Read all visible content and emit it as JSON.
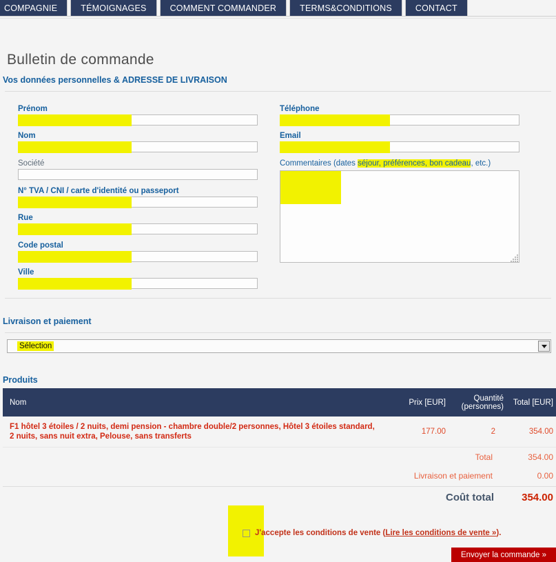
{
  "nav": {
    "tabs": [
      {
        "label": "COMPAGNIE"
      },
      {
        "label": "TÉMOIGNAGES"
      },
      {
        "label": "COMMENT COMMANDER"
      },
      {
        "label": "TERMS&CONDITIONS"
      },
      {
        "label": "CONTACT"
      }
    ]
  },
  "page": {
    "title": "Bulletin de commande"
  },
  "sections": {
    "personal": "Vos données personnelles & ADRESSE DE LIVRAISON",
    "delivery": "Livraison et paiement",
    "products": "Produits"
  },
  "form": {
    "left": [
      {
        "label": "Prénom",
        "value": "",
        "required": true
      },
      {
        "label": "Nom",
        "value": "",
        "required": true
      },
      {
        "label": "Société",
        "value": "",
        "required": false
      },
      {
        "label": "N° TVA / CNI / carte d'identité ou passeport",
        "value": "",
        "required": true
      },
      {
        "label": "Rue",
        "value": "",
        "required": true
      },
      {
        "label": "Code postal",
        "value": "",
        "required": true
      },
      {
        "label": "Ville",
        "value": "",
        "required": true
      }
    ],
    "right": [
      {
        "label": "Téléphone",
        "value": "",
        "required": true
      },
      {
        "label": "Email",
        "value": "",
        "required": true
      }
    ],
    "comments": {
      "label_part1": "Commentaires (dates ",
      "label_part2": "séjour, préférences, bon cadeau",
      "label_part3": ", etc.)",
      "value": ""
    }
  },
  "delivery": {
    "select_value": "Sélection"
  },
  "products": {
    "columns": {
      "name": "Nom",
      "price": "Prix [EUR]",
      "quantity_line1": "Quantité",
      "quantity_line2": "(personnes)",
      "total": "Total [EUR]"
    },
    "rows": [
      {
        "name": "F1 hôtel 3 étoiles / 2 nuits, demi pension - chambre double/2 personnes, Hôtel 3 étoiles standard, 2 nuits, sans nuit extra, Pelouse, sans transferts",
        "price": "177.00",
        "quantity": "2",
        "total": "354.00"
      }
    ],
    "summary": [
      {
        "label": "Total",
        "value": "354.00"
      },
      {
        "label": "Livraison et paiement",
        "value": "0.00"
      }
    ],
    "grand_total": {
      "label": "Coût total",
      "value": "354.00"
    }
  },
  "consent": {
    "text_before": "J'accepte les conditions de vente (",
    "link": "Lire les conditions de vente »",
    "text_after": ").",
    "checked": false
  },
  "submit": {
    "label": "Envoyer la commande »"
  },
  "colors": {
    "nav_tab_bg": "#2c3c60",
    "table_header_bg": "#2c3c60",
    "heading_blue": "#17609e",
    "product_red": "#d22a14",
    "grand_total_red": "#cc2200",
    "submit_red": "#bb0000",
    "marker_yellow": "#f2f200",
    "page_bg": "#f4f4f4"
  }
}
